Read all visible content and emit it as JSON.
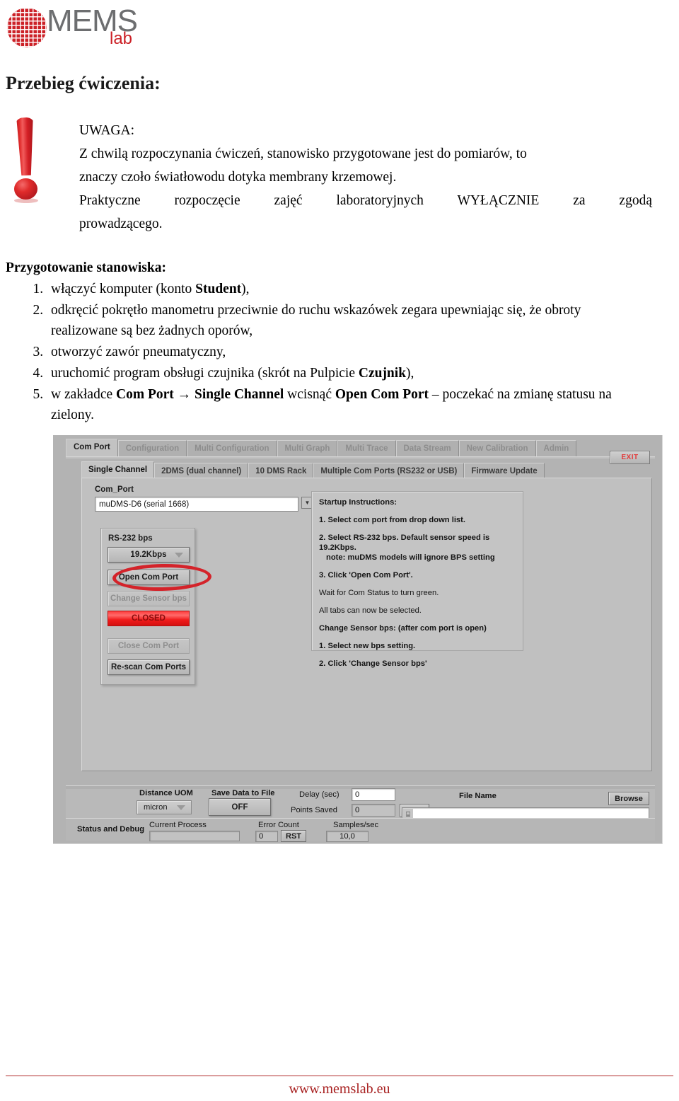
{
  "logo": {
    "mems_text": "MEMS",
    "lab_text": "lab",
    "wafer_icon": "wafer-circle-icon",
    "brand_red": "#cc2127",
    "brand_gray": "#6d6e70"
  },
  "heading": "Przebieg ćwiczenia:",
  "warning": {
    "icon": "exclamation-mark-icon",
    "title": "UWAGA:",
    "line1": "Z chwilą rozpoczynania ćwiczeń, stanowisko przygotowane jest do pomiarów, to",
    "line2": "znaczy czoło światłowodu dotyka membrany krzemowej.",
    "line3": "Praktyczne rozpoczęcie zajęć laboratoryjnych WYŁĄCZNIE za zgodą",
    "line4": "prowadzącego."
  },
  "prep": {
    "heading": "Przygotowanie stanowiska:",
    "steps": [
      {
        "parts": [
          {
            "t": "włączyć komputer (konto ",
            "b": false
          },
          {
            "t": "Student",
            "b": true
          },
          {
            "t": "),",
            "b": false
          }
        ]
      },
      {
        "parts": [
          {
            "t": "odkręcić pokrętło manometru przeciwnie do ruchu wskazówek zegara upewniając się, że obroty realizowane są bez żadnych oporów,",
            "b": false
          }
        ]
      },
      {
        "parts": [
          {
            "t": "otworzyć zawór pneumatyczny,",
            "b": false
          }
        ]
      },
      {
        "parts": [
          {
            "t": "uruchomić program obsługi czujnika (skrót na Pulpicie ",
            "b": false
          },
          {
            "t": "Czujnik",
            "b": true
          },
          {
            "t": "),",
            "b": false
          }
        ]
      },
      {
        "parts": [
          {
            "t": "w zakładce ",
            "b": false
          },
          {
            "t": "Com Port",
            "b": true
          },
          {
            "t": " → ",
            "b": false
          },
          {
            "t": "Single Channel",
            "b": true
          },
          {
            "t": " wcisnąć ",
            "b": false
          },
          {
            "t": "Open Com Port",
            "b": true
          },
          {
            "t": " – poczekać na zmianę statusu na zielony.",
            "b": false
          }
        ]
      }
    ]
  },
  "app": {
    "tabs": [
      {
        "label": "Com Port",
        "active": true
      },
      {
        "label": "Configuration",
        "active": false
      },
      {
        "label": "Multi Configuration",
        "active": false
      },
      {
        "label": "Multi Graph",
        "active": false
      },
      {
        "label": "Multi Trace",
        "active": false
      },
      {
        "label": "Data Stream",
        "active": false
      },
      {
        "label": "New Calibration",
        "active": false
      },
      {
        "label": "Admin",
        "active": false
      }
    ],
    "subtabs": [
      {
        "label": "Single Channel",
        "active": true
      },
      {
        "label": "2DMS (dual channel)",
        "active": false
      },
      {
        "label": "10 DMS Rack",
        "active": false
      },
      {
        "label": "Multiple Com Ports (RS232 or USB)",
        "active": false
      },
      {
        "label": "Firmware Update",
        "active": false
      }
    ],
    "exit_label": "EXIT",
    "comport": {
      "label": "Com_Port",
      "value": "muDMS-D6 (serial 1668)",
      "dropdown_icon": "chevron-down-icon"
    },
    "bps_group": {
      "title": "RS-232 bps",
      "bps_value": "19.2Kbps",
      "open_button": "Open Com Port",
      "change_button": "Change Sensor bps",
      "status_led": "CLOSED",
      "status_color": "#f01b1b",
      "close_button": "Close Com Port",
      "rescan_button": "Re-scan Com Ports"
    },
    "instructions": {
      "title": "Startup Instructions:",
      "i1": "1. Select com port from drop down list.",
      "i2": "2. Select RS-232 bps.  Default sensor speed is 19.2Kbps.",
      "i2_note": "note: muDMS models will ignore BPS setting",
      "i3": "3. Click 'Open Com Port'.",
      "i4": "Wait for Com Status to turn green.",
      "i5": "All tabs can now be selected.",
      "i6": "Change Sensor bps: (after com port is open)",
      "i7": "1. Select new bps setting.",
      "i8": "2. Click 'Change Sensor bps'"
    },
    "toolbar": {
      "distance_uom_label": "Distance UOM",
      "distance_uom_value": "micron",
      "save_label": "Save Data to File",
      "save_value": "OFF",
      "delay_label": "Delay (sec)",
      "delay_value": "0",
      "points_label": "Points Saved",
      "points_value": "0",
      "rst_label": "RST",
      "filename_label": "File Name",
      "filename_value": "",
      "browse_label": "Browse"
    },
    "statusbar": {
      "title": "Status and Debug",
      "current_process_label": "Current Process",
      "current_process_value": "",
      "error_count_label": "Error Count",
      "error_count_value": "0",
      "rst_label": "RST",
      "samples_label": "Samples/sec",
      "samples_value": "10,0"
    }
  },
  "footer": {
    "url": "www.memslab.eu",
    "rule_color": "#b12b2b"
  }
}
